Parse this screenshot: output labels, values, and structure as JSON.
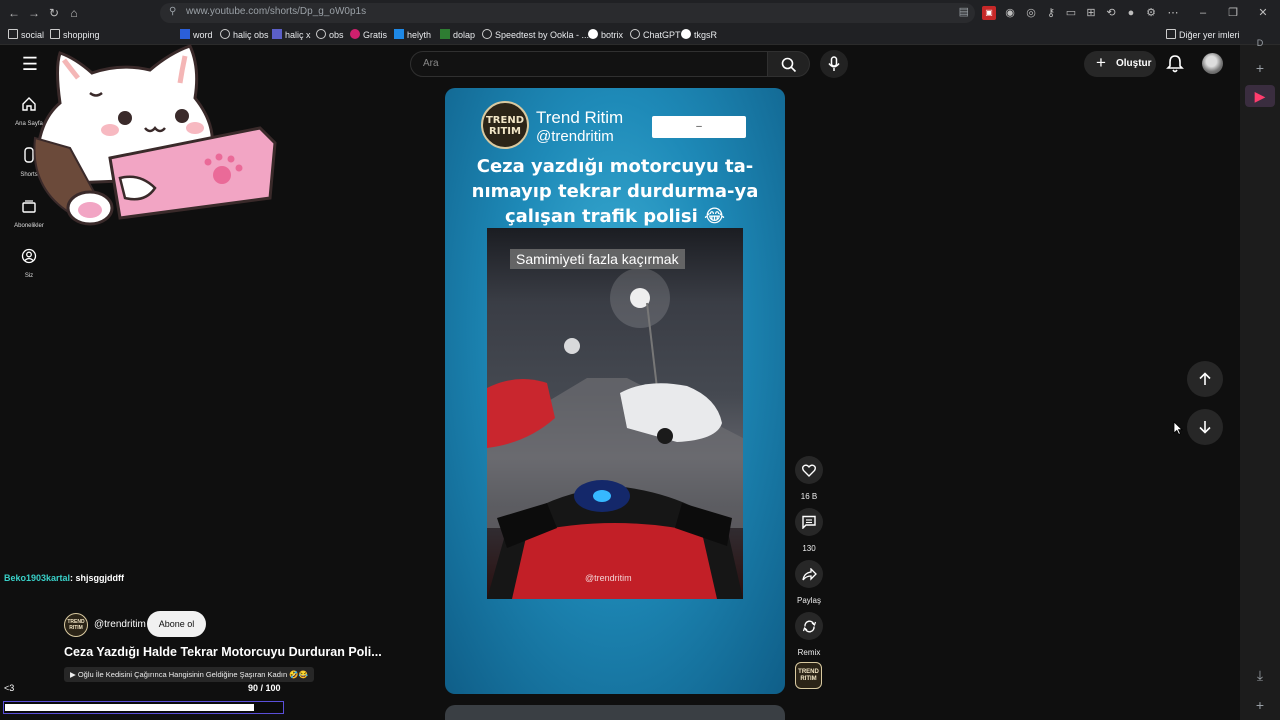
{
  "browser": {
    "url": "www.youtube.com/shorts/Dp_g_oW0p1s",
    "bookmarks": [
      "social",
      "shopping",
      "word",
      "haliç obs",
      "haliç x",
      "obs",
      "Gratis",
      "helyth",
      "dolap",
      "Speedtest by Ookla - ...",
      "botrix",
      "ChatGPT",
      "tkgsR"
    ],
    "other_bookmarks": "Diğer yer imleri"
  },
  "yt": {
    "search_placeholder": "Ara",
    "create_label": "Oluştur",
    "sidebar": [
      {
        "label": "Ana Sayfa",
        "icon": "home-icon"
      },
      {
        "label": "Shorts",
        "icon": "shorts-icon"
      },
      {
        "label": "Abonelikler",
        "icon": "subscriptions-icon"
      },
      {
        "label": "Siz",
        "icon": "you-icon"
      }
    ]
  },
  "short": {
    "channel_logo_text": "TREND RITIM",
    "channel_name": "Trend Ritim",
    "channel_handle": "@trendritim",
    "sub_pill_text": "–",
    "headline": "Ceza yazdığı motorcuyu ta-nımayıp tekrar durdurma-ya çalışan trafik polisi 😂",
    "caption": "Samimiyeti fazla kaçırmak",
    "watermark": "@trendritim"
  },
  "actions": {
    "like_count": "16 B",
    "comment_count": "130",
    "share_label": "Paylaş",
    "remix_label": "Remix"
  },
  "info": {
    "chat_user": "Beko1903kartal",
    "chat_message": ": shjsggjddff",
    "channel_handle": "@trendritim",
    "subscribe_label": "Abone ol",
    "title": "Ceza Yazdığı Halde Tekrar Motorcuyu Durduran Poli...",
    "related": "▶ Oğlu İle Kedisini Çağırınca Hangisinin Geldiğine Şaşıran Kadın 🤣😂",
    "heart_text": "<3",
    "progress_text": "90 / 100",
    "progress_fraction": 0.9
  }
}
